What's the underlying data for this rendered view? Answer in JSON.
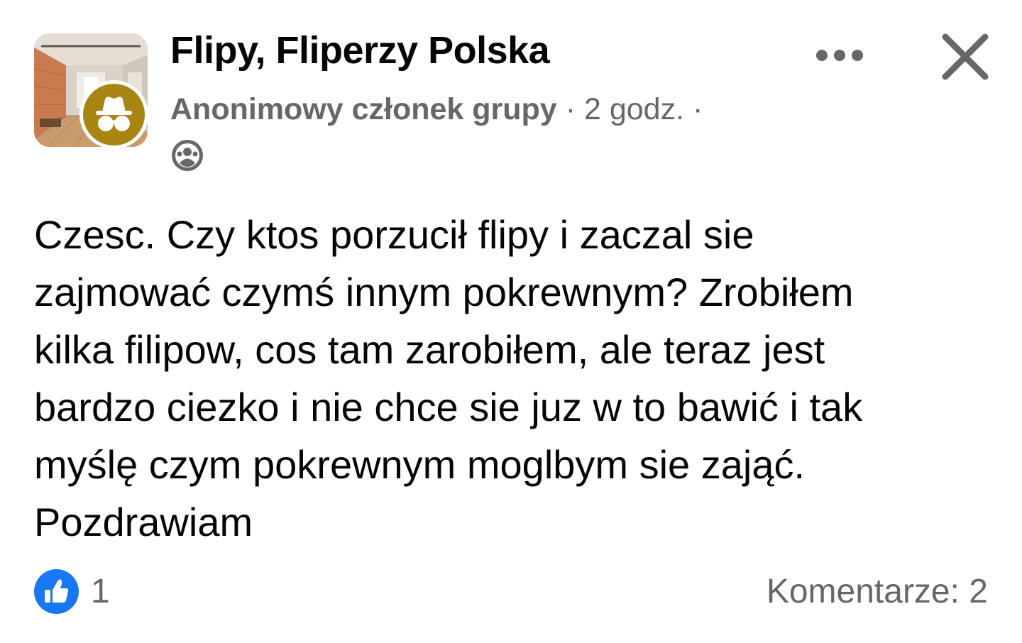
{
  "post": {
    "group_name": "Flipy, Fliperzy Polska",
    "author": "Anonimowy członek grupy",
    "separator": "·",
    "time": "2 godz.",
    "privacy_icon": "group-members-icon",
    "body": "Czesc. Czy ktos porzucił flipy i zaczal sie\nzajmować czymś innym pokrewnym? Zrobiłem\nkilka filipow, cos tam zarobiłem, ale teraz jest\nbardzo ciezko i nie chce sie juz w to bawić i tak\nmyślę czym pokrewnym moglbym sie zająć.\nPozdrawiam",
    "reactions": {
      "icon": "like-icon",
      "count": "1"
    },
    "comments_label": "Komentarze: 2"
  },
  "icons": {
    "more": "more-dots-icon",
    "close": "close-icon",
    "anonymous_badge": "incognito-icon"
  },
  "colors": {
    "primary_text": "#050505",
    "secondary_text": "#65676b",
    "like_blue": "#1877f2",
    "anon_badge_gold": "#a88412"
  }
}
